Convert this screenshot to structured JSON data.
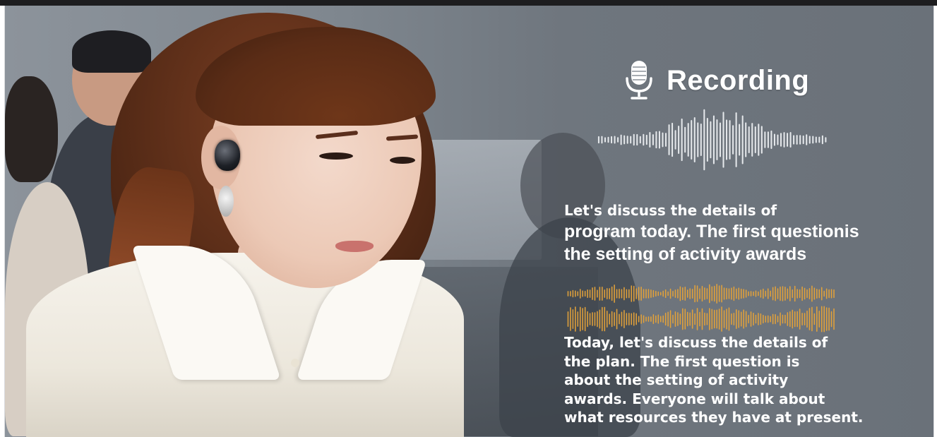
{
  "header": {
    "title": "Recording",
    "icon": "microphone-icon"
  },
  "colors": {
    "waveform_primary": "#e5e8eb",
    "waveform_translation": "#e3a23a",
    "text": "#ffffff"
  },
  "transcript_original": {
    "lines": [
      "Let's discuss the details of",
      "program today. The first questionis",
      "the setting of activity awards"
    ]
  },
  "transcript_translated": {
    "lines": [
      "Today, let's discuss the details of",
      "the plan. The first question is",
      "about the setting of activity",
      "awards. Everyone will talk about",
      "what resources they have at present."
    ]
  }
}
